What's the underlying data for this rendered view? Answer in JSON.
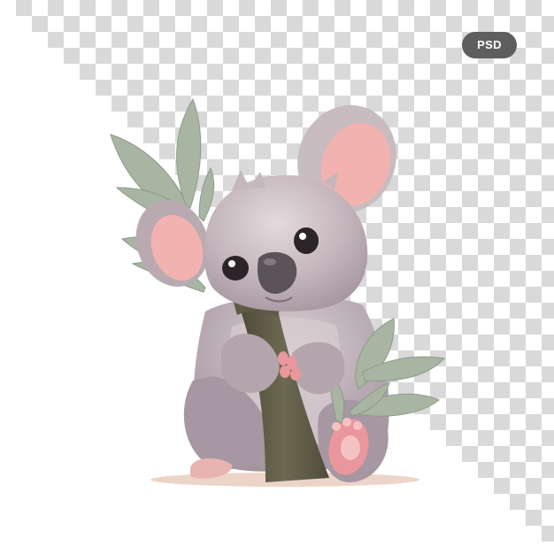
{
  "badge": {
    "label": "PSD"
  },
  "illustration": {
    "subject": "koala-icon",
    "colors": {
      "fur": "#b3a5ab",
      "fur_light": "#ddd2d6",
      "ear_inner": "#f2b3b0",
      "nose": "#5b5358",
      "branch": "#5d5a45",
      "leaf": "#a9b5a3",
      "paw_pad": "#e9979c"
    }
  }
}
